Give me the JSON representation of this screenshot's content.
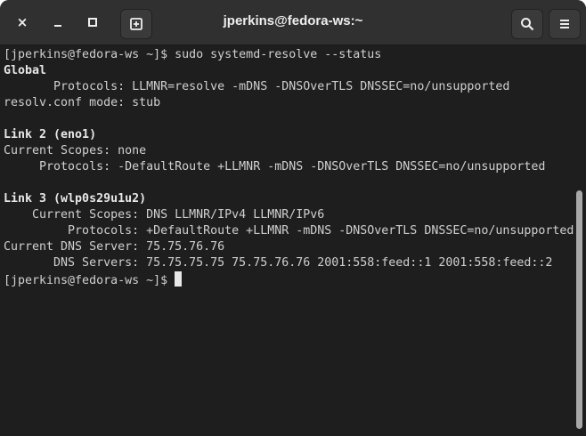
{
  "window": {
    "title": "jperkins@fedora-ws:~",
    "buttons": {
      "close": "×",
      "minimize": "_",
      "maximize": "▫"
    },
    "icons": [
      "new-tab-icon",
      "search-icon",
      "hamburger-menu-icon"
    ]
  },
  "terminal": {
    "lines": [
      {
        "text": "[jperkins@fedora-ws ~]$ sudo systemd-resolve --status",
        "bold": false
      },
      {
        "text": "Global",
        "bold": true
      },
      {
        "text": "       Protocols: LLMNR=resolve -mDNS -DNSOverTLS DNSSEC=no/unsupported",
        "bold": false
      },
      {
        "text": "resolv.conf mode: stub",
        "bold": false
      },
      {
        "text": "",
        "bold": false
      },
      {
        "text": "Link 2 (eno1)",
        "bold": true
      },
      {
        "text": "Current Scopes: none",
        "bold": false
      },
      {
        "text": "     Protocols: -DefaultRoute +LLMNR -mDNS -DNSOverTLS DNSSEC=no/unsupported",
        "bold": false
      },
      {
        "text": "",
        "bold": false
      },
      {
        "text": "Link 3 (wlp0s29u1u2)",
        "bold": true
      },
      {
        "text": "    Current Scopes: DNS LLMNR/IPv4 LLMNR/IPv6",
        "bold": false
      },
      {
        "text": "         Protocols: +DefaultRoute +LLMNR -mDNS -DNSOverTLS DNSSEC=no/unsupported",
        "bold": false
      },
      {
        "text": "Current DNS Server: 75.75.76.76",
        "bold": false
      },
      {
        "text": "       DNS Servers: 75.75.75.75 75.75.76.76 2001:558:feed::1 2001:558:feed::2",
        "bold": false
      }
    ],
    "prompt": "[jperkins@fedora-ws ~]$ "
  }
}
